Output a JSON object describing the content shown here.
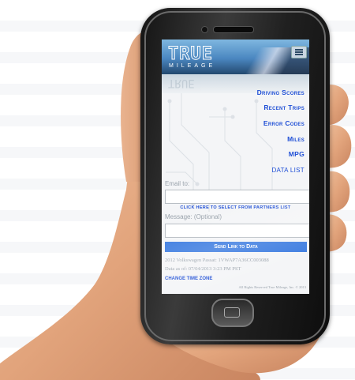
{
  "header": {
    "logo_main": "TRUE",
    "logo_sub": "MILEAGE",
    "menu_icon": "hamburger-menu-icon"
  },
  "nav": {
    "items": [
      {
        "label": "Driving Scores"
      },
      {
        "label": "Recent Trips"
      },
      {
        "label": "Error Codes"
      },
      {
        "label": "Miles"
      },
      {
        "label": "MPG"
      },
      {
        "label": "DATA LIST"
      }
    ]
  },
  "form": {
    "email_label": "Email to:",
    "email_value": "",
    "partners_link": "CLICK HERE TO SELECT FROM PARTNERS LIST",
    "message_label": "Message: (Optional)",
    "message_value": "",
    "send_button": "Send Link to Data"
  },
  "info": {
    "vehicle": "2012 Volkswagen Passat: 1VWAP7A36CC003088",
    "data_as_of": "Data as of: 07/04/2013 3:23 PM PST",
    "change_tz": "CHANGE TIME ZONE",
    "copyright": "All Rights Reserved True Mileage, Inc. © 2013"
  },
  "colors": {
    "link_blue": "#1f4fd6",
    "button_blue": "#3b7be0",
    "phone_body": "#1e1e1e",
    "skin": "#e3a882"
  }
}
